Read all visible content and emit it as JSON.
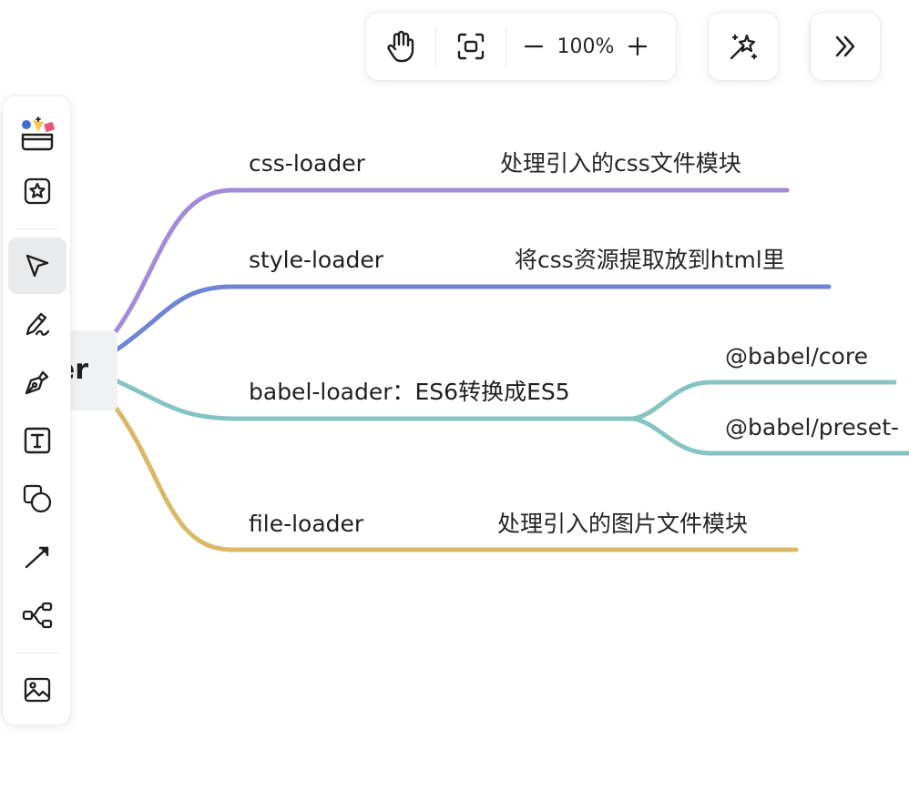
{
  "toolbar": {
    "zoom_level": "100%",
    "tools": [
      "hand-icon",
      "fit-screen-icon",
      "zoom-out-icon",
      "zoom-in-icon",
      "magic-wand-icon",
      "double-chevron-right-icon"
    ]
  },
  "side_toolbar": {
    "tools": [
      "templates-icon",
      "star-sticker-icon",
      "select-cursor-icon",
      "pen-icon",
      "fountain-pen-icon",
      "text-icon",
      "shapes-icon",
      "connector-arrow-icon",
      "mindmap-icon",
      "image-icon"
    ],
    "active": "select-cursor-icon"
  },
  "mindmap": {
    "root": {
      "label": "er"
    },
    "branches": [
      {
        "label": "css-loader",
        "note": "处理引入的css文件模块",
        "color": "#a58ad9"
      },
      {
        "label": "style-loader",
        "note": "将css资源提取放到html里",
        "color": "#6e84d4"
      },
      {
        "label": "babel-loader：ES6转换成ES5",
        "color": "#86c4c4",
        "children": [
          {
            "label": "@babel/core"
          },
          {
            "label": "@babel/preset-"
          }
        ]
      },
      {
        "label": "file-loader",
        "note": "处理引入的图片文件模块",
        "color": "#d9b866"
      }
    ]
  }
}
